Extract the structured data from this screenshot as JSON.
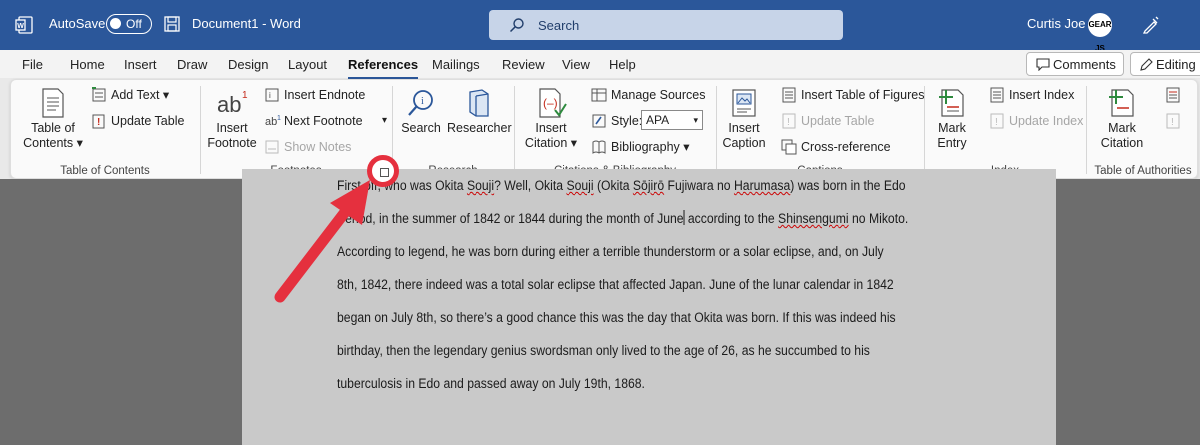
{
  "titlebar": {
    "autosave_label": "AutoSave",
    "autosave_state": "Off",
    "document_title": "Document1 - Word",
    "search_placeholder": "Search",
    "user_name": "Curtis Joe",
    "avatar_text": "GEAR JS"
  },
  "menu": {
    "tabs": [
      "File",
      "Home",
      "Insert",
      "Draw",
      "Design",
      "Layout",
      "References",
      "Mailings",
      "Review",
      "View",
      "Help"
    ],
    "active_tab": "References",
    "comments_label": "Comments",
    "editing_label": "Editing"
  },
  "ribbon": {
    "toc": {
      "table_of_contents_label_1": "Table of",
      "table_of_contents_label_2": "Contents",
      "add_text": "Add Text",
      "update_table": "Update Table",
      "group_label": "Table of Contents"
    },
    "footnotes": {
      "insert_footnote_1": "Insert",
      "insert_footnote_2": "Footnote",
      "insert_endnote": "Insert Endnote",
      "next_footnote": "Next Footnote",
      "show_notes": "Show Notes",
      "group_label": "Footnotes"
    },
    "research": {
      "search": "Search",
      "researcher": "Researcher",
      "group_label": "Research"
    },
    "citations": {
      "insert_citation_1": "Insert",
      "insert_citation_2": "Citation",
      "manage_sources": "Manage Sources",
      "style_label": "Style:",
      "style_value": "APA",
      "bibliography": "Bibliography",
      "group_label": "Citations & Bibliography"
    },
    "captions": {
      "insert_caption_1": "Insert",
      "insert_caption_2": "Caption",
      "insert_table_of_figures": "Insert Table of Figures",
      "update_table": "Update Table",
      "cross_reference": "Cross-reference",
      "group_label": "Captions"
    },
    "index": {
      "mark_entry_1": "Mark",
      "mark_entry_2": "Entry",
      "insert_index": "Insert Index",
      "update_index": "Update Index",
      "group_label": "Index"
    },
    "authorities": {
      "mark_citation_1": "Mark",
      "mark_citation_2": "Citation",
      "group_label": "Table of Authorities"
    }
  },
  "document": {
    "line1_a": "First off, who was Okita ",
    "line1_b": "Souji",
    "line1_c": "? Well, Okita ",
    "line1_d": "Souji",
    "line1_e": " (Okita ",
    "line1_f": "Sōjirō",
    "line1_g": " Fujiwara no ",
    "line1_h": "Harumasa",
    "line1_i": ") was born in the Edo",
    "line2_a": "Period, in the summer of 1842 or 1844 during the month of June",
    "line2_b": " according to the ",
    "line2_c": "Shinsengumi",
    "line2_d": " no Mikoto.",
    "line3": "According to legend, he was born during either a terrible thunderstorm or a solar eclipse, and, on July",
    "line4": "8th, 1842, there indeed was a total solar eclipse that affected Japan. June of the lunar calendar in 1842",
    "line5": "began on July 8th, so there’s a good chance this was the day that Okita was born. If this was indeed his",
    "line6": "birthday, then the legendary genius swordsman only lived to the age of 26, as he succumbed to his",
    "line7": "tuberculosis in Edo and passed away on July 19th, 1868."
  },
  "colors": {
    "word_blue": "#2b579a",
    "highlight_red": "#e5303e"
  }
}
